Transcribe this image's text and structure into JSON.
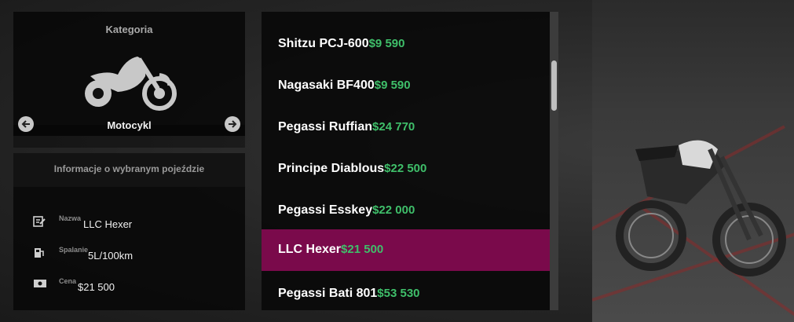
{
  "category": {
    "title": "Kategoria",
    "label": "Motocykl",
    "icon": "motorcycle-icon"
  },
  "info": {
    "title": "Informacje o wybranym pojeździe",
    "rows": [
      {
        "key": "Nazwa",
        "value": "LLC Hexer",
        "icon": "id-card-icon"
      },
      {
        "key": "Spalanie",
        "value": "5L/100km",
        "icon": "fuel-pump-icon"
      },
      {
        "key": "Cena",
        "value": "$21 500",
        "icon": "banknote-icon"
      }
    ]
  },
  "vehicles": [
    {
      "name": "Shitzu PCJ-600",
      "price": "$9 590"
    },
    {
      "name": "Nagasaki BF400",
      "price": "$9 590"
    },
    {
      "name": "Pegassi Ruffian",
      "price": "$24 770"
    },
    {
      "name": "Principe Diablous",
      "price": "$22 500"
    },
    {
      "name": "Pegassi Esskey",
      "price": "$22 000"
    },
    {
      "name": "LLC Hexer",
      "price": "$21 500"
    },
    {
      "name": "Pegassi Bati 801",
      "price": "$53 530"
    }
  ],
  "selected_index": 5,
  "colors": {
    "selected": "#7a0a4b",
    "price": "#3fbf6a"
  }
}
